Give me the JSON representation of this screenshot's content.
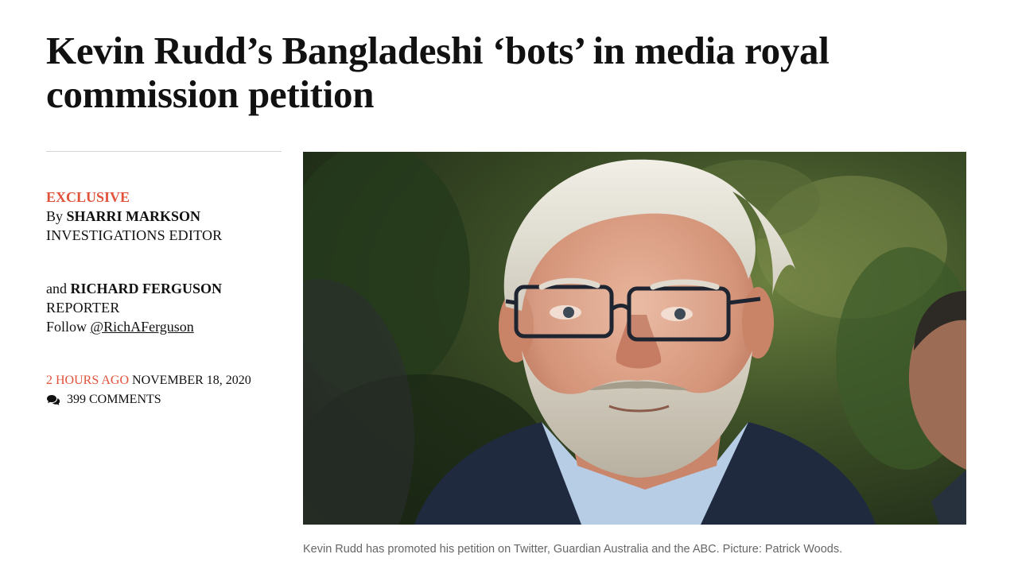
{
  "article": {
    "headline_line1": "Kevin Rudd’s Bangladeshi ‘bots’ in media royal",
    "headline_line2": "commission petition",
    "tag": "EXCLUSIVE",
    "authors": [
      {
        "prefix": "By",
        "name": "SHARRI MARKSON",
        "role": "INVESTIGATIONS EDITOR"
      },
      {
        "prefix": "and",
        "name": "RICHARD FERGUSON",
        "role": "REPORTER",
        "follow_prefix": "Follow",
        "follow_handle": "@RichAFerguson"
      }
    ],
    "time_ago": "2 HOURS AGO",
    "date": "NOVEMBER 18, 2020",
    "comments": "399 COMMENTS",
    "comments_icon": "comments-icon",
    "image_alt": "Kevin Rudd",
    "caption": "Kevin Rudd has promoted his petition on Twitter, Guardian Australia and the ABC. Picture: Patrick Woods."
  },
  "colors": {
    "accent": "#e2523a",
    "text": "#111111",
    "caption": "#666666",
    "divider": "#d6d6d6"
  }
}
